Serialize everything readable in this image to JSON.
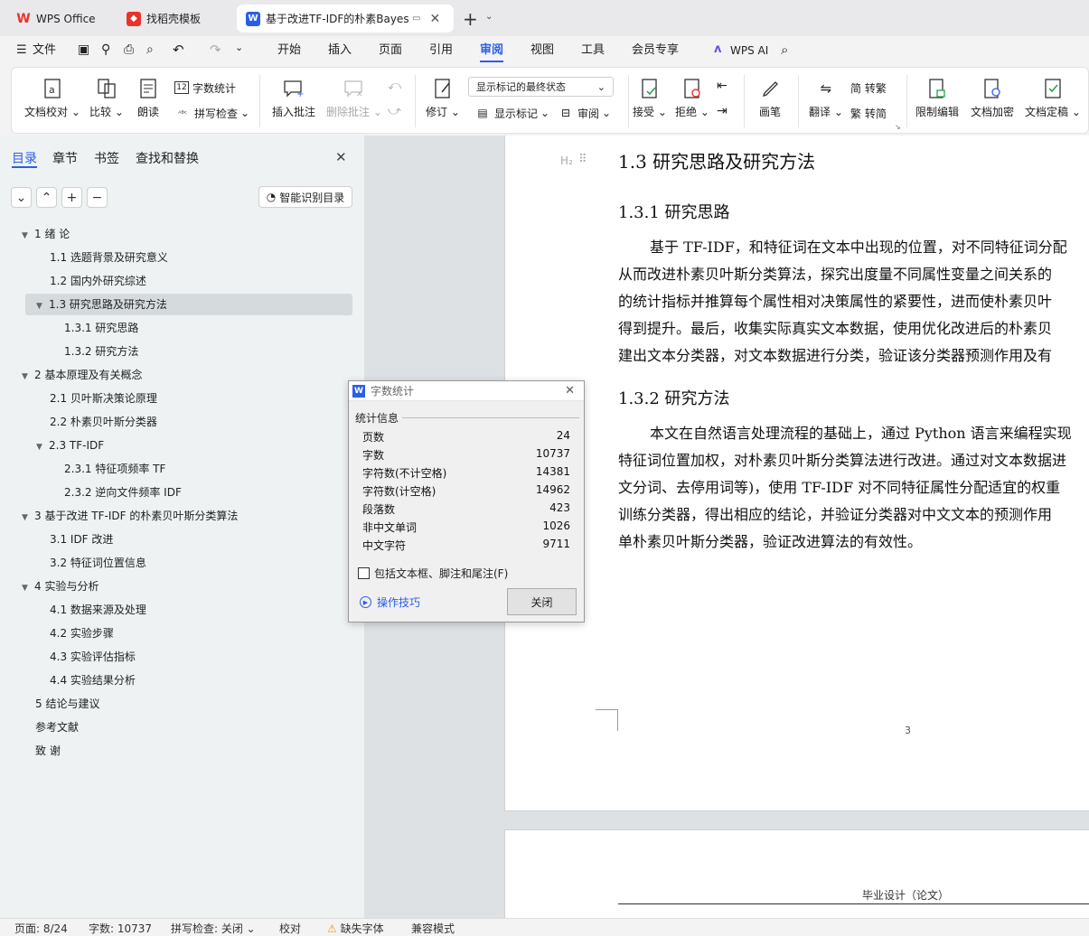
{
  "tabs": [
    {
      "label": "WPS Office"
    },
    {
      "label": "找稻壳模板"
    },
    {
      "label": "基于改进TF-IDF的朴素Bayes..."
    }
  ],
  "menu": {
    "file": "文件",
    "items": [
      "开始",
      "插入",
      "页面",
      "引用",
      "审阅",
      "视图",
      "工具",
      "会员专享"
    ],
    "wps_ai": "WPS AI"
  },
  "ribbon": {
    "doc_proof": "文档校对",
    "compare": "比较",
    "read_aloud": "朗读",
    "word_count": "字数统计",
    "spell_check": "拼写检查",
    "insert_comment": "插入批注",
    "delete_comment": "删除批注",
    "revise": "修订",
    "markup_state": "显示标记的最终状态",
    "show_markup": "显示标记",
    "review": "审阅",
    "accept": "接受",
    "reject": "拒绝",
    "pen": "画笔",
    "translate": "翻译",
    "to_traditional": "简 转繁",
    "to_simplified": "繁 转简",
    "restrict_edit": "限制编辑",
    "encrypt": "文档加密",
    "finalize": "文档定稿"
  },
  "sidebar": {
    "tabs": [
      "目录",
      "章节",
      "书签",
      "查找和替换"
    ],
    "smart_toc": "智能识别目录",
    "toc": [
      {
        "label": "1  绪  论"
      },
      {
        "label": "1.1  选题背景及研究意义"
      },
      {
        "label": "1.2  国内外研究综述"
      },
      {
        "label": "1.3  研究思路及研究方法"
      },
      {
        "label": "1.3.1  研究思路"
      },
      {
        "label": "1.3.2  研究方法"
      },
      {
        "label": "2  基本原理及有关概念"
      },
      {
        "label": "2.1  贝叶斯决策论原理"
      },
      {
        "label": "2.2  朴素贝叶斯分类器"
      },
      {
        "label": "2.3 TF-IDF"
      },
      {
        "label": "2.3.1  特征项频率 TF"
      },
      {
        "label": "2.3.2  逆向文件频率 IDF"
      },
      {
        "label": "3  基于改进 TF-IDF 的朴素贝叶斯分类算法"
      },
      {
        "label": "3.1 IDF 改进"
      },
      {
        "label": "3.2  特征词位置信息"
      },
      {
        "label": "4  实验与分析"
      },
      {
        "label": "4.1  数据来源及处理"
      },
      {
        "label": "4.2  实验步骤"
      },
      {
        "label": "4.3  实验评估指标"
      },
      {
        "label": "4.4  实验结果分析"
      },
      {
        "label": "5  结论与建议"
      },
      {
        "label": "参考文献"
      },
      {
        "label": "致  谢"
      }
    ]
  },
  "document": {
    "heading_mark": "H₂",
    "h2": "1.3  研究思路及研究方法",
    "h3a": "1.3.1  研究思路",
    "p1": [
      "基于 TF-IDF，和特征词在文本中出现的位置，对不同特征词分配",
      "从而改进朴素贝叶斯分类算法，探究出度量不同属性变量之间关系的",
      "的统计指标并推算每个属性相对决策属性的紧要性，进而使朴素贝叶",
      "得到提升。最后，收集实际真实文本数据，使用优化改进后的朴素贝",
      "建出文本分类器，对文本数据进行分类，验证该分类器预测作用及有"
    ],
    "h3b": "1.3.2  研究方法",
    "p2": [
      "本文在自然语言处理流程的基础上，通过 Python 语言来编程实现",
      "特征词位置加权，对朴素贝叶斯分类算法进行改进。通过对文本数据进",
      "文分词、去停用词等)，使用 TF-IDF 对不同特征属性分配适宜的权重",
      "训练分类器，得出相应的结论，并验证分类器对中文文本的预测作用",
      "单朴素贝叶斯分类器，验证改进算法的有效性。"
    ],
    "page_number": "3",
    "next_header": "毕业设计（论文）"
  },
  "dialog": {
    "title": "字数统计",
    "section": "统计信息",
    "rows": [
      {
        "label": "页数",
        "value": "24"
      },
      {
        "label": "字数",
        "value": "10737"
      },
      {
        "label": "字符数(不计空格)",
        "value": "14381"
      },
      {
        "label": "字符数(计空格)",
        "value": "14962"
      },
      {
        "label": "段落数",
        "value": "423"
      },
      {
        "label": "非中文单词",
        "value": "1026"
      },
      {
        "label": "中文字符",
        "value": "9711"
      }
    ],
    "checkbox": "包括文本框、脚注和尾注(F)",
    "tips": "操作技巧",
    "close": "关闭"
  },
  "status": {
    "page": "页面: 8/24",
    "words": "字数: 10737",
    "spell": "拼写检查: 关闭",
    "proof": "校对",
    "missing_font": "缺失字体",
    "compat": "兼容模式"
  },
  "colors": {
    "accent": "#2b5ee8",
    "wps_red": "#e8332a"
  }
}
